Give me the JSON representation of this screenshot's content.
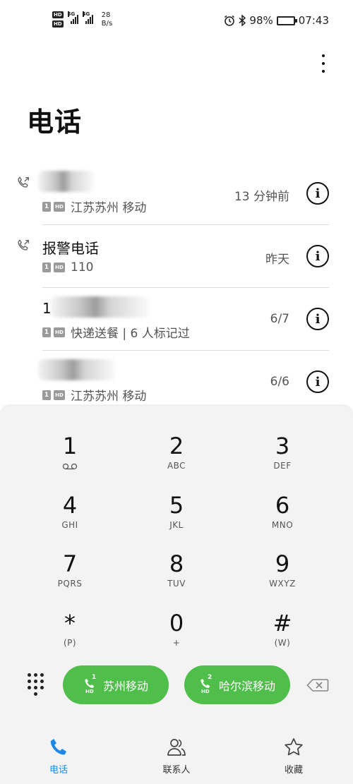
{
  "status_bar": {
    "network_1": "5G",
    "network_2": "4G",
    "speed_value": "28",
    "speed_unit": "B/s",
    "battery": "98%",
    "time": "07:43"
  },
  "page": {
    "title": "电话"
  },
  "call_log": [
    {
      "name": "",
      "sim": "1",
      "hd": "HD",
      "detail": "江苏苏州 移动",
      "time": "13 分钟前",
      "type": "outgoing",
      "name_blurred": true
    },
    {
      "name": "报警电话",
      "sim": "1",
      "hd": "HD",
      "detail": "110",
      "time": "昨天",
      "type": "outgoing",
      "name_blurred": false
    },
    {
      "name": "1",
      "sim": "1",
      "hd": "HD",
      "detail": "快递送餐 | 6 人标记过",
      "time": "6/7",
      "type": "none",
      "name_blurred": true
    },
    {
      "name": "",
      "sim": "1",
      "hd": "HD",
      "detail": "江苏苏州 移动",
      "time": "6/6",
      "type": "none",
      "name_blurred": true
    }
  ],
  "dialpad": {
    "keys": [
      {
        "digit": "1",
        "letters": ""
      },
      {
        "digit": "2",
        "letters": "ABC"
      },
      {
        "digit": "3",
        "letters": "DEF"
      },
      {
        "digit": "4",
        "letters": "GHI"
      },
      {
        "digit": "5",
        "letters": "JKL"
      },
      {
        "digit": "6",
        "letters": "MNO"
      },
      {
        "digit": "7",
        "letters": "PQRS"
      },
      {
        "digit": "8",
        "letters": "TUV"
      },
      {
        "digit": "9",
        "letters": "WXYZ"
      },
      {
        "digit": "*",
        "letters": "(P)"
      },
      {
        "digit": "0",
        "letters": "+"
      },
      {
        "digit": "#",
        "letters": "(W)"
      }
    ],
    "call_sim1": {
      "label": "苏州移动",
      "sim": "1",
      "hd": "HD"
    },
    "call_sim2": {
      "label": "哈尔滨移动",
      "sim": "2",
      "hd": "HD"
    },
    "accent_color": "#4fbe4a"
  },
  "bottom_nav": [
    {
      "label": "电话",
      "icon": "phone-icon",
      "active": true
    },
    {
      "label": "联系人",
      "icon": "contacts-icon",
      "active": false
    },
    {
      "label": "收藏",
      "icon": "star-icon",
      "active": false
    }
  ],
  "active_color": "#1e88e5"
}
